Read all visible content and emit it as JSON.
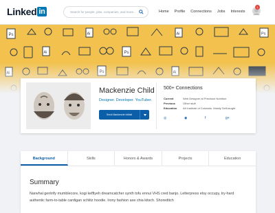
{
  "header": {
    "logo_text": "Linked",
    "logo_in": "in",
    "search_placeholder": "Search for people, jobs, companies, and more...",
    "nav": [
      "Home",
      "Profile",
      "Connections",
      "Jobs",
      "Interests"
    ],
    "notification_count": "1"
  },
  "profile": {
    "name": "Mackenzie Child",
    "tagline": "Designer. Developer. YouTuber.",
    "send_button": "Send Mackenzie InMail",
    "connections": "500+ Connections",
    "info": [
      {
        "key": "Current",
        "value": "Web Designer at Precision Nutrition"
      },
      {
        "key": "Previous",
        "value": "Other stuff"
      },
      {
        "key": "Education",
        "value": "Art Institute of Colorado. Mainly Self-taught"
      }
    ],
    "socials": [
      "instagram-icon",
      "dribbble-icon",
      "facebook-icon",
      "google-plus-icon"
    ],
    "social_glyphs": [
      "◎",
      "◉",
      "f",
      "g+"
    ]
  },
  "tabs": [
    "Background",
    "Skills",
    "Honors & Awards",
    "Projects",
    "Education"
  ],
  "active_tab": "Background",
  "summary": {
    "title": "Summary",
    "text": "Narwhal gentrify mumblecore, kogi keffiyeh dreamcatcher synth tofu ennui VHS cred banjo. Letterpress etsy occupy, try-hard authentic farm-to-table cardigan schlitz hoodie. Irony fashion axe chia kitsch. Shoreditch"
  },
  "colors": {
    "banner": "#f2c14e",
    "accent": "#0b5ea8",
    "badge": "#e2473f"
  }
}
